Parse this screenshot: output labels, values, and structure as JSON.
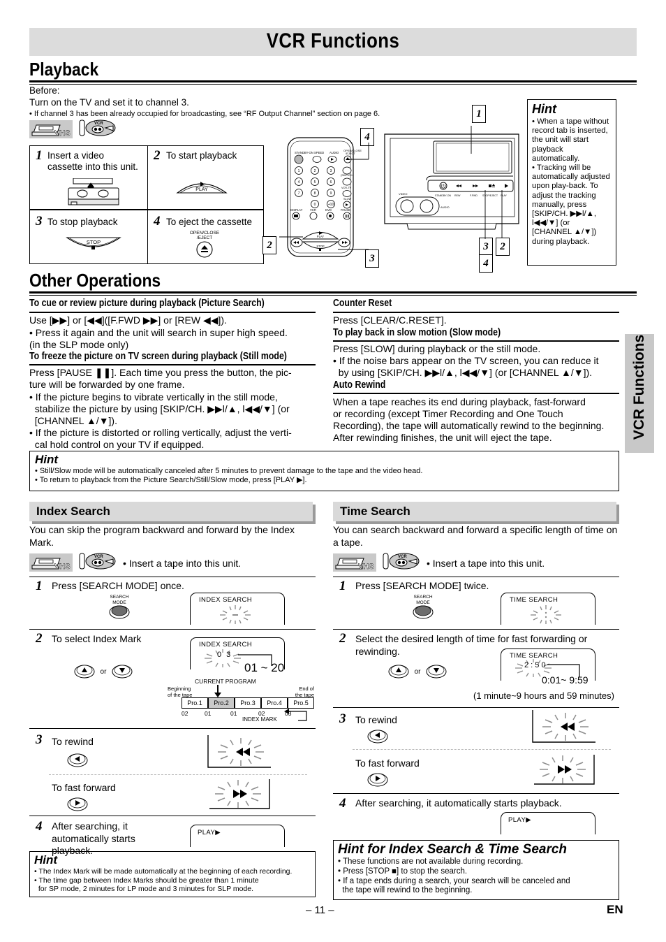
{
  "page": {
    "title": "VCR Functions",
    "side_tab": "VCR Functions",
    "page_number": "– 11 –",
    "lang_code": "EN"
  },
  "playback": {
    "heading": "Playback",
    "before_label": "Before:",
    "before_line1": "Turn on the TV and set it to channel 3.",
    "before_line2": "• If channel 3 has been already occupied for broadcasting, see “RF Output Channel” section on page 6.",
    "icons": {
      "tape": "vhs-tape-icon",
      "disc": "vcr-disc-icon"
    },
    "steps": [
      {
        "num": "1",
        "text": "Insert a video cassette into this unit.",
        "button": ""
      },
      {
        "num": "2",
        "text": "To start playback",
        "button": "PLAY"
      },
      {
        "num": "3",
        "text": "To stop playback",
        "button": "STOP"
      },
      {
        "num": "4",
        "text": "To eject the cassette",
        "button": "OPEN/CLOSE\n/EJECT"
      }
    ],
    "callouts": [
      "1",
      "2",
      "3",
      "4"
    ],
    "hint": {
      "title": "Hint",
      "bullets": [
        "• When a tape without record tab is inserted, the unit will start playback automatically.",
        "• Tracking will be automatically adjusted upon play-back. To adjust the tracking manually, press [SKIP/CH. ▶▶l/▲, l◀◀/▼] (or [CHANNEL ▲/▼]) during playback."
      ]
    },
    "remote": {
      "labels": [
        "STANDBY-ON",
        "SPEED",
        "AUDIO",
        "OPEN/CLOSE /EJECT",
        "(SKIP/CH.)",
        "VCR/TV",
        "SLOW",
        "DISPLAY",
        "VCR",
        "DVD",
        "PAUSE",
        "PLAY",
        "STOP"
      ],
      "keys": [
        "1",
        "2",
        "3",
        "4",
        "5",
        "6",
        "7",
        "8",
        "9",
        "0",
        "+10"
      ]
    },
    "vcr_panel": {
      "labels": [
        "VIDEO",
        "AUDIO",
        "STANDBY-ON",
        "REW",
        "F.FWD",
        "STOP/EJECT",
        "PLAY"
      ]
    }
  },
  "other_operations": {
    "heading": "Other Operations",
    "left": [
      {
        "subheading": "To cue or review picture during playback (Picture Search)",
        "lines": [
          "Use [▶▶] or [◀◀]([F.FWD ▶▶] or [REW ◀◀]).",
          "• Press it again and the unit will search in super high speed.",
          "  (in the SLP mode only)"
        ]
      },
      {
        "subheading": "To freeze the picture on TV screen during playback (Still mode)",
        "lines": [
          "Press [PAUSE ❚❚]. Each time you press the button, the pic-",
          "ture will be forwarded by one frame.",
          "• If the picture begins to vibrate vertically in the still mode,",
          "  stabilize the picture by using [SKIP/CH. ▶▶l/▲, l◀◀/▼] (or",
          "  [CHANNEL ▲/▼]).",
          "• If the picture is distorted or rolling vertically, adjust the verti-",
          "  cal hold control on your TV if equipped."
        ]
      }
    ],
    "right": [
      {
        "subheading": "Counter Reset",
        "lines": [
          "Press [CLEAR/C.RESET]."
        ]
      },
      {
        "subheading": "To play back in slow motion (Slow mode)",
        "lines": [
          "Press [SLOW] during playback or the still mode.",
          "• If the noise bars appear on the TV screen, you can reduce it",
          "  by using [SKIP/CH. ▶▶l/▲, l◀◀/▼] (or [CHANNEL ▲/▼])."
        ]
      },
      {
        "subheading": "Auto Rewind",
        "lines": [
          "When a tape reaches its end during playback, fast-forward",
          "or recording (except Timer Recording and One Touch",
          "Recording), the tape will automatically rewind to the beginning.",
          "After rewinding finishes, the unit will eject the tape."
        ]
      }
    ],
    "hint": {
      "title": "Hint",
      "bullets": [
        "• Still/Slow mode will be automatically canceled after 5 minutes to prevent damage to the tape and the video head.",
        "• To return to playback from the Picture Search/Still/Slow mode, press [PLAY ▶]."
      ]
    }
  },
  "index_search": {
    "heading": "Index Search",
    "intro": "You can skip the program backward and forward by the Index Mark.",
    "insert_note": "• Insert a tape into this unit.",
    "steps": [
      {
        "num": "1",
        "text": "Press [SEARCH MODE] once.",
        "button_label": "SEARCH\nMODE",
        "display": "INDEX SEARCH"
      },
      {
        "num": "2",
        "text": "To select Index Mark",
        "button_label": "or",
        "display": "INDEX SEARCH",
        "display_value": "0 3",
        "range": "01 ~ 20"
      },
      {
        "num": "3",
        "text": "To rewind",
        "text2": "To fast forward",
        "display": "◀◀",
        "display2": "▶▶"
      },
      {
        "num": "4",
        "text": "After searching, it automatically starts playback.",
        "display": "PLAY▶"
      }
    ],
    "diagram": {
      "current_program_label": "CURRENT PROGRAM",
      "begin_label": "Beginning\nof the tape",
      "end_label": "End of\nthe tape",
      "index_mark_label": "INDEX MARK",
      "programs": [
        "Pro.1",
        "Pro.2",
        "Pro.3",
        "Pro.4",
        "Pro.5"
      ],
      "selected_index": 1,
      "marks": [
        "02",
        "01",
        "01",
        "02",
        "03"
      ]
    },
    "hint": {
      "title": "Hint",
      "bullets": [
        "• The Index Mark will be made automatically at the beginning of each recording.",
        "• The time gap between Index Marks should be greater than 1 minute",
        "  for SP mode, 2 minutes for LP mode and 3 minutes for SLP mode."
      ]
    }
  },
  "time_search": {
    "heading": "Time Search",
    "intro": "You can search backward and forward a specific length of time on a tape.",
    "insert_note": "• Insert a tape into this unit.",
    "steps": [
      {
        "num": "1",
        "text": "Press [SEARCH MODE] twice.",
        "button_label": "SEARCH\nMODE",
        "display": "TIME SEARCH"
      },
      {
        "num": "2",
        "text": "Select the desired length of time for fast forwarding or rewinding.",
        "display": "TIME SEARCH",
        "display_value": "2 : 5 0",
        "range": "0:01~ 9:59",
        "range_note": "(1 minute~9 hours and 59 minutes)"
      },
      {
        "num": "3",
        "text": "To rewind",
        "text2": "To fast forward",
        "display": "◀◀",
        "display2": "▶▶"
      },
      {
        "num": "4",
        "text": "After searching, it automatically starts playback.",
        "display": "PLAY▶"
      }
    ]
  },
  "bottom_hint": {
    "title": "Hint for Index Search & Time Search",
    "bullets": [
      "• These functions are not available during recording.",
      "• Press [STOP ■] to stop the search.",
      "• If a tape ends during a search, your search will be canceled and",
      "  the tape will rewind to the beginning."
    ]
  }
}
